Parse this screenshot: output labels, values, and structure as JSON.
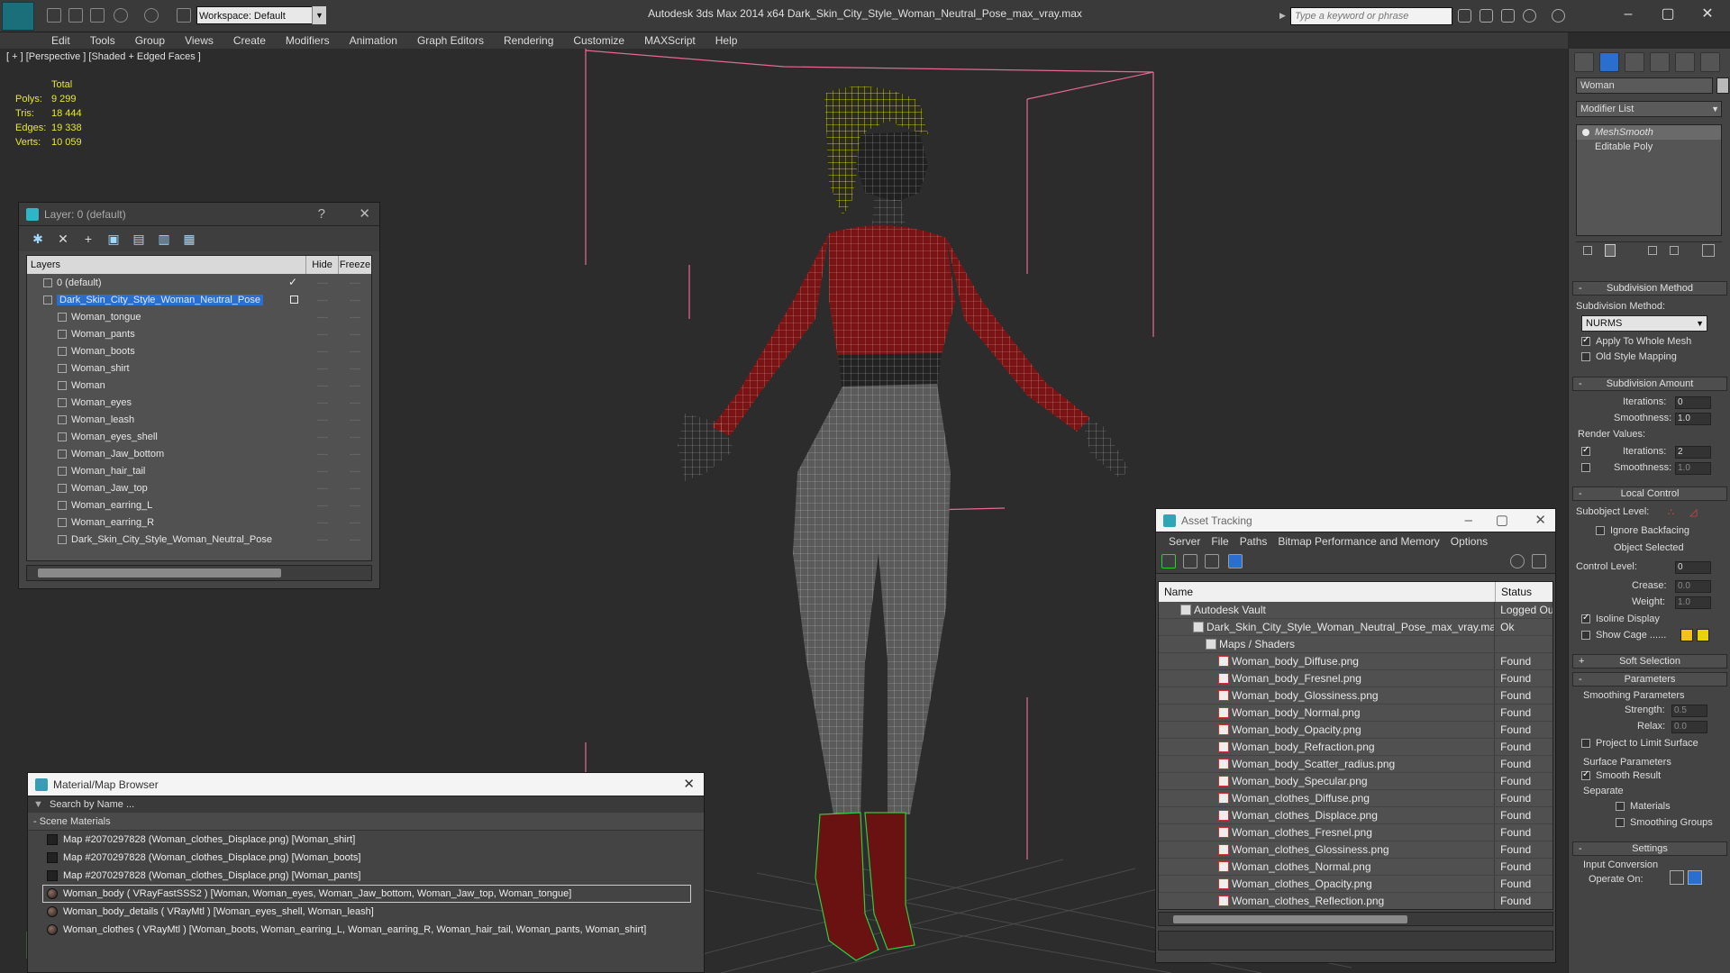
{
  "app": {
    "title": "Autodesk 3ds Max  2014 x64     Dark_Skin_City_Style_Woman_Neutral_Pose_max_vray.max",
    "workspace": "Workspace: Default",
    "search_placeholder": "Type a keyword or phrase"
  },
  "menu": [
    "Edit",
    "Tools",
    "Group",
    "Views",
    "Create",
    "Modifiers",
    "Animation",
    "Graph Editors",
    "Rendering",
    "Customize",
    "MAXScript",
    "Help"
  ],
  "viewport": {
    "label": "[ + ] [Perspective ] [Shaded + Edged Faces ]",
    "stats": {
      "header": "Total",
      "rows": [
        {
          "label": "Polys:",
          "value": "9 299"
        },
        {
          "label": "Tris:",
          "value": "18 444"
        },
        {
          "label": "Edges:",
          "value": "19 338"
        },
        {
          "label": "Verts:",
          "value": "10 059"
        }
      ]
    }
  },
  "layer_panel": {
    "title": "Layer: 0 (default)",
    "help": "?",
    "close": "✕",
    "columns": {
      "name": "Layers",
      "hide": "Hide",
      "freeze": "Freeze"
    },
    "rows": [
      {
        "name": "0 (default)",
        "indent": 1,
        "check": "✓"
      },
      {
        "name": "Dark_Skin_City_Style_Woman_Neutral_Pose",
        "indent": 1,
        "selected": true
      },
      {
        "name": "Woman_tongue",
        "indent": 2
      },
      {
        "name": "Woman_pants",
        "indent": 2
      },
      {
        "name": "Woman_boots",
        "indent": 2
      },
      {
        "name": "Woman_shirt",
        "indent": 2
      },
      {
        "name": "Woman",
        "indent": 2
      },
      {
        "name": "Woman_eyes",
        "indent": 2
      },
      {
        "name": "Woman_leash",
        "indent": 2
      },
      {
        "name": "Woman_eyes_shell",
        "indent": 2
      },
      {
        "name": "Woman_Jaw_bottom",
        "indent": 2
      },
      {
        "name": "Woman_hair_tail",
        "indent": 2
      },
      {
        "name": "Woman_Jaw_top",
        "indent": 2
      },
      {
        "name": "Woman_earring_L",
        "indent": 2
      },
      {
        "name": "Woman_earring_R",
        "indent": 2
      },
      {
        "name": "Dark_Skin_City_Style_Woman_Neutral_Pose",
        "indent": 2
      }
    ],
    "cell_mark": "----"
  },
  "material_browser": {
    "title": "Material/Map Browser",
    "search_placeholder": "Search by Name ...",
    "section": "- Scene Materials",
    "rows": [
      {
        "text": "Map #2070297828 (Woman_clothes_Displace.png) [Woman_shirt]",
        "kind": "map"
      },
      {
        "text": "Map #2070297828 (Woman_clothes_Displace.png) [Woman_boots]",
        "kind": "map"
      },
      {
        "text": "Map #2070297828 (Woman_clothes_Displace.png) [Woman_pants]",
        "kind": "map"
      },
      {
        "text": "Woman_body  ( VRayFastSSS2 )  [Woman, Woman_eyes, Woman_Jaw_bottom, Woman_Jaw_top, Woman_tongue]",
        "kind": "mat",
        "selected": true
      },
      {
        "text": "Woman_body_details  ( VRayMtl )  [Woman_eyes_shell, Woman_leash]",
        "kind": "mat"
      },
      {
        "text": "Woman_clothes  ( VRayMtl )  [Woman_boots, Woman_earring_L, Woman_earring_R, Woman_hair_tail, Woman_pants, Woman_shirt]",
        "kind": "mat"
      }
    ]
  },
  "asset_tracking": {
    "title": "Asset Tracking",
    "menu": [
      "Server",
      "File",
      "Paths",
      "Bitmap Performance and Memory",
      "Options"
    ],
    "columns": {
      "name": "Name",
      "status": "Status"
    },
    "rows": [
      {
        "name": "Autodesk Vault",
        "status": "Logged Out",
        "indent": 1,
        "icon": "vault"
      },
      {
        "name": "Dark_Skin_City_Style_Woman_Neutral_Pose_max_vray.max",
        "status": "Ok",
        "indent": 2,
        "icon": "max"
      },
      {
        "name": "Maps / Shaders",
        "status": "",
        "indent": 3,
        "icon": "maps"
      },
      {
        "name": "Woman_body_Diffuse.png",
        "status": "Found",
        "indent": 4,
        "icon": "png"
      },
      {
        "name": "Woman_body_Fresnel.png",
        "status": "Found",
        "indent": 4,
        "icon": "png"
      },
      {
        "name": "Woman_body_Glossiness.png",
        "status": "Found",
        "indent": 4,
        "icon": "png"
      },
      {
        "name": "Woman_body_Normal.png",
        "status": "Found",
        "indent": 4,
        "icon": "png"
      },
      {
        "name": "Woman_body_Opacity.png",
        "status": "Found",
        "indent": 4,
        "icon": "png"
      },
      {
        "name": "Woman_body_Refraction.png",
        "status": "Found",
        "indent": 4,
        "icon": "png"
      },
      {
        "name": "Woman_body_Scatter_radius.png",
        "status": "Found",
        "indent": 4,
        "icon": "png"
      },
      {
        "name": "Woman_body_Specular.png",
        "status": "Found",
        "indent": 4,
        "icon": "png"
      },
      {
        "name": "Woman_clothes_Diffuse.png",
        "status": "Found",
        "indent": 4,
        "icon": "png"
      },
      {
        "name": "Woman_clothes_Displace.png",
        "status": "Found",
        "indent": 4,
        "icon": "png"
      },
      {
        "name": "Woman_clothes_Fresnel.png",
        "status": "Found",
        "indent": 4,
        "icon": "png"
      },
      {
        "name": "Woman_clothes_Glossiness.png",
        "status": "Found",
        "indent": 4,
        "icon": "png"
      },
      {
        "name": "Woman_clothes_Normal.png",
        "status": "Found",
        "indent": 4,
        "icon": "png"
      },
      {
        "name": "Woman_clothes_Opacity.png",
        "status": "Found",
        "indent": 4,
        "icon": "png"
      },
      {
        "name": "Woman_clothes_Reflection.png",
        "status": "Found",
        "indent": 4,
        "icon": "png"
      }
    ]
  },
  "command_panel": {
    "object_name": "Woman",
    "modifier_list": "Modifier List",
    "stack": [
      "MeshSmooth",
      "Editable Poly"
    ],
    "subdivision_method": {
      "title": "Subdivision Method",
      "label": "Subdivision Method:",
      "value": "NURMS",
      "apply_whole_mesh": "Apply To Whole Mesh",
      "old_style": "Old Style Mapping"
    },
    "subdivision_amount": {
      "title": "Subdivision Amount",
      "iterations_label": "Iterations:",
      "iterations": "0",
      "smoothness_label": "Smoothness:",
      "smoothness": "1.0",
      "render_values": "Render Values:",
      "r_iterations_label": "Iterations:",
      "r_iterations": "2",
      "r_smoothness_label": "Smoothness:",
      "r_smoothness": "1.0"
    },
    "local_control": {
      "title": "Local Control",
      "subobject": "Subobject Level:",
      "ignore_backfacing": "Ignore Backfacing",
      "object_selected": "Object Selected",
      "control_level_label": "Control Level:",
      "control_level": "0",
      "crease_label": "Crease:",
      "crease": "0.0",
      "weight_label": "Weight:",
      "weight": "1.0",
      "isoline": "Isoline Display",
      "show_cage": "Show Cage ......"
    },
    "soft_selection": "Soft Selection",
    "parameters": {
      "title": "Parameters",
      "group": "Smoothing Parameters",
      "strength_label": "Strength:",
      "strength": "0.5",
      "relax_label": "Relax:",
      "relax": "0.0",
      "project": "Project to Limit Surface",
      "surface_group": "Surface Parameters",
      "smooth_result": "Smooth Result",
      "separate": "Separate",
      "materials": "Materials",
      "smoothing_groups": "Smoothing Groups"
    },
    "settings": {
      "title": "Settings",
      "input_conversion": "Input Conversion",
      "operate_on": "Operate On:"
    }
  },
  "colors": {
    "accent": "#2a6fd0",
    "cage_yellow": "#f2c21a",
    "cage_orange": "#e8d400",
    "shirt": "#7a1414",
    "pants": "#5a5a5a",
    "wire": "#ffffff"
  }
}
